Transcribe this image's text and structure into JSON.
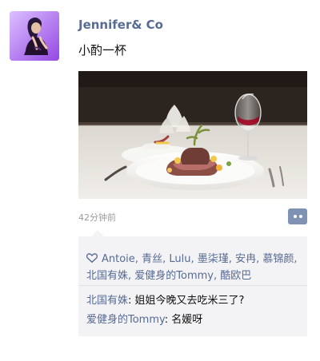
{
  "post": {
    "username": "Jennifer& Co",
    "text": "小酌一杯",
    "time": "42分钟前"
  },
  "likes": {
    "names": [
      "Antoie",
      "青丝",
      "Lulu",
      "墨柒瑾",
      "安冉",
      "慕锦颜",
      "北国有姝",
      "爱健身的Tommy",
      "酷欧巴"
    ],
    "separator": ","
  },
  "comments": [
    {
      "author": "北国有姝",
      "separator": ": ",
      "text": "姐姐今晚又去吃米三了?"
    },
    {
      "author": "爱健身的Tommy",
      "separator": ": ",
      "text": "名媛呀"
    }
  ],
  "colors": {
    "name_blue": "#576b95",
    "time_gray": "#9b9b9b",
    "comment_bg": "#f3f3f5",
    "button_bg": "#7f92b3"
  },
  "icons": {
    "avatar": "profile-photo",
    "photo": "dinner-plate-photo",
    "heart": "heart-outline-icon",
    "more": "more-actions-icon"
  }
}
